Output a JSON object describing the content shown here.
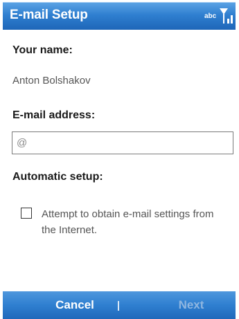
{
  "window": {
    "title": "E-mail Setup",
    "input_indicator": "abc",
    "signal_icon": "signal-strength-icon"
  },
  "form": {
    "name_label": "Your name:",
    "name_value": "Anton Bolshakov",
    "email_label": "E-mail address:",
    "email_value": "@",
    "auto_setup_label": "Automatic setup:",
    "checkbox_text": "Attempt to obtain e-mail settings from the Internet.",
    "checkbox_checked": false
  },
  "softkeys": {
    "left": "Cancel",
    "right": "Next"
  },
  "colors": {
    "titlebar": "#2f7fd0",
    "softkey_bar": "#2f7fd0",
    "disabled_softkey": "#8fb6e0"
  }
}
